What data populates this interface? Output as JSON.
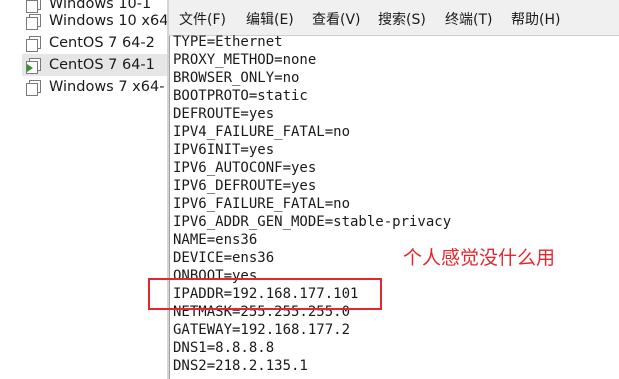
{
  "vm_list": [
    {
      "label": "Windows 10-1",
      "selected": false,
      "running": false
    },
    {
      "label": "Windows 10 x64",
      "selected": false,
      "running": false
    },
    {
      "label": "CentOS 7 64-2",
      "selected": false,
      "running": false
    },
    {
      "label": "CentOS 7 64-1",
      "selected": true,
      "running": true
    },
    {
      "label": "Windows 7 x64-",
      "selected": false,
      "running": false
    }
  ],
  "menu": [
    {
      "label": "文件(F)"
    },
    {
      "label": "编辑(E)"
    },
    {
      "label": "查看(V)"
    },
    {
      "label": "搜索(S)"
    },
    {
      "label": "终端(T)"
    },
    {
      "label": "帮助(H)"
    }
  ],
  "file_lines": [
    "TYPE=Ethernet",
    "PROXY_METHOD=none",
    "BROWSER_ONLY=no",
    "BOOTPROTO=static",
    "DEFROUTE=yes",
    "IPV4_FAILURE_FATAL=no",
    "IPV6INIT=yes",
    "IPV6_AUTOCONF=yes",
    "IPV6_DEFROUTE=yes",
    "IPV6_FAILURE_FATAL=no",
    "IPV6_ADDR_GEN_MODE=stable-privacy",
    "NAME=ens36",
    "DEVICE=ens36",
    "ONBOOT=yes",
    "IPADDR=192.168.177.101",
    "NETMASK=255.255.255.0",
    "GATEWAY=192.168.177.2",
    "DNS1=8.8.8.8",
    "DNS2=218.2.135.1"
  ],
  "annotation": {
    "note": "个人感觉没什么用",
    "color": "#e0282e"
  },
  "colors": {
    "menu_background": "#f0f0f0",
    "selected_row": "#e6e6e6",
    "running_indicator": "#2e9a2e"
  }
}
